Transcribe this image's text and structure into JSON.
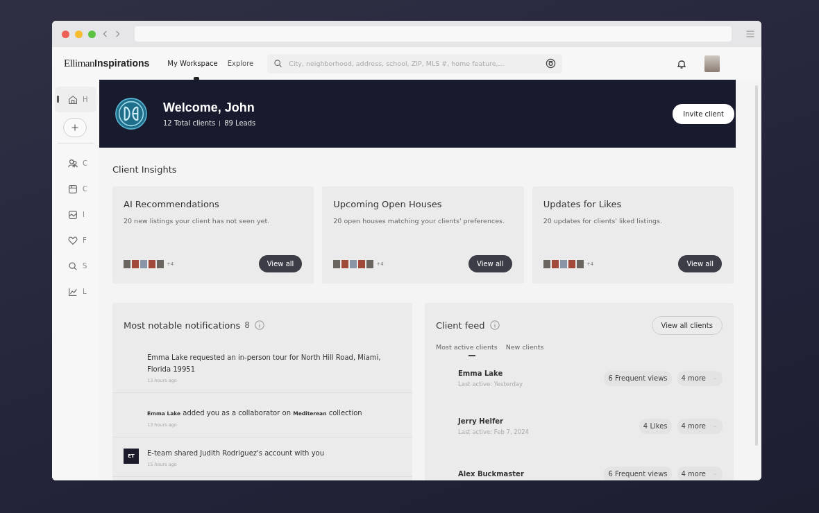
{
  "app": {
    "logo": {
      "serif": "Elliman",
      "bold": "Inspirations"
    },
    "nav": [
      {
        "label": "My Workspace",
        "selected": true
      },
      {
        "label": "Explore",
        "selected": false
      }
    ],
    "search": {
      "placeholder": "City, neighborhood, address, school, ZIP, MLS #, home feature,..."
    }
  },
  "sidebar": {
    "items": [
      {
        "kind": "home",
        "label": "H",
        "selected": true
      },
      {
        "kind": "add",
        "selected": false
      },
      {
        "kind": "people",
        "label": "C",
        "selected": false
      },
      {
        "kind": "notebook",
        "label": "C",
        "selected": false
      },
      {
        "kind": "image",
        "label": "I",
        "selected": false
      },
      {
        "kind": "heart",
        "label": "F",
        "selected": false
      },
      {
        "kind": "search",
        "label": "S",
        "selected": false
      },
      {
        "kind": "chart",
        "label": "L",
        "selected": false
      }
    ]
  },
  "banner": {
    "title": "Welcome, John",
    "stats": [
      "12 Total clients",
      "89 Leads"
    ],
    "button": "Invite client"
  },
  "insights": {
    "title": "Client Insights",
    "cards": [
      {
        "title": "AI Recommendations",
        "description": "20 new listings your client has not seen yet.",
        "more": "+4",
        "button": "View all"
      },
      {
        "title": "Upcoming Open Houses",
        "description": "20 open houses matching your clients' preferences.",
        "more": "+4",
        "button": "View all"
      },
      {
        "title": "Updates for Likes",
        "description": "20 updates for clients' liked listings.",
        "more": "+4",
        "button": "View all"
      }
    ]
  },
  "notifications": {
    "title": "Most notable notifications",
    "count": "8",
    "items": [
      {
        "text": "Emma Lake requested an in-person tour for North Hill Road, Miami, Florida 19951",
        "time": "13 hours ago"
      },
      {
        "text": "**Emma Lake** added you as a collaborator on **Mediterean** collection",
        "time": "13 hours ago"
      },
      {
        "badge": "ET",
        "text": "E-team shared Judith Rodriguez's account with you",
        "time": "15 hours ago"
      }
    ]
  },
  "client_feed": {
    "title": "Client feed",
    "button": "View all clients",
    "tabs": [
      {
        "label": "Most active clients",
        "selected": true
      },
      {
        "label": "New clients",
        "selected": false
      }
    ],
    "clients": [
      {
        "name": "Emma Lake",
        "last_active": "Last active: Yesterday",
        "chips": [
          "6 Frequent views"
        ],
        "more": "4 more"
      },
      {
        "name": "Jerry Helfer",
        "last_active": "Last active: Feb 7, 2024",
        "chips": [
          "4 Likes"
        ],
        "more": "4 more"
      },
      {
        "name": "Alex Buckmaster",
        "chips": [
          "6 Frequent views"
        ],
        "more": "4 more"
      }
    ]
  }
}
